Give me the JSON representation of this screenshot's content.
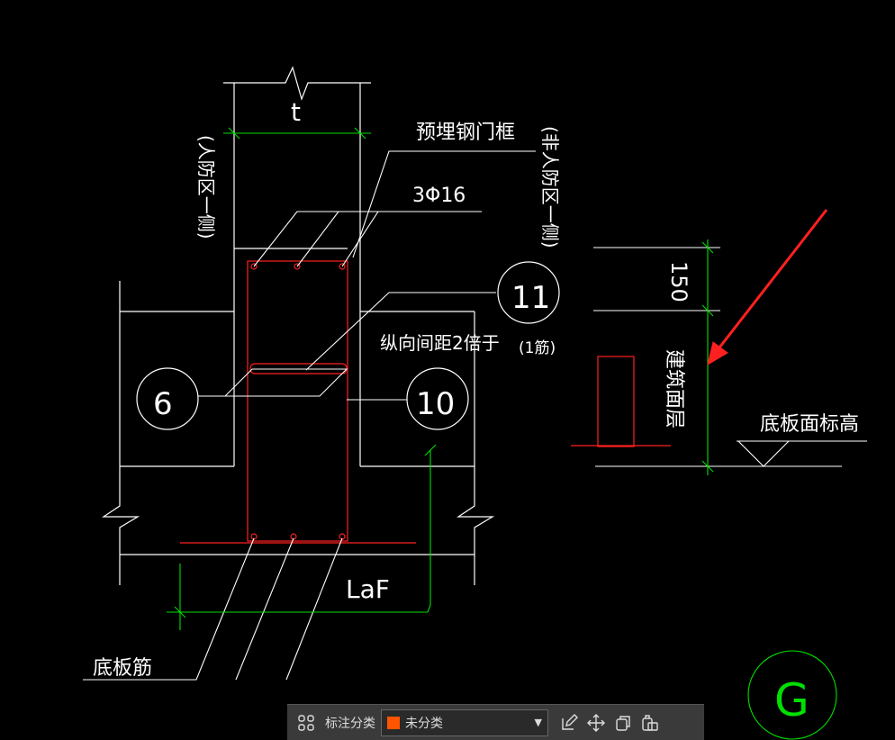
{
  "drawing": {
    "dim_t": "t",
    "label_embedded_frame": "预埋钢门框",
    "label_rebar": "3Φ16",
    "label_civil_side": "(人防区一侧)",
    "label_noncivil_side": "(非人防区一侧)",
    "label_longitudinal_spacing": "纵向间距2倍于",
    "label_rib_11": "11",
    "label_rib_1": "(1筋)",
    "circle_6": "6",
    "circle_10": "10",
    "label_laf": "LaF",
    "label_bottom_rebar": "底板筋",
    "dim_150": "150",
    "label_building_surface": "建筑面层",
    "label_slab_elevation": "底板面标高",
    "grid_g": "G"
  },
  "colors": {
    "line_white": "#ffffff",
    "line_red": "#ff2020",
    "line_green": "#00e000",
    "arrow_red": "#ff2020",
    "swatch": "#ff5500"
  },
  "toolbar": {
    "annotation_category_label": "标注分类",
    "selected_category": "未分类",
    "icons": [
      "grid-icon",
      "edit-icon",
      "move-icon",
      "copy-icon",
      "paste-icon"
    ]
  }
}
